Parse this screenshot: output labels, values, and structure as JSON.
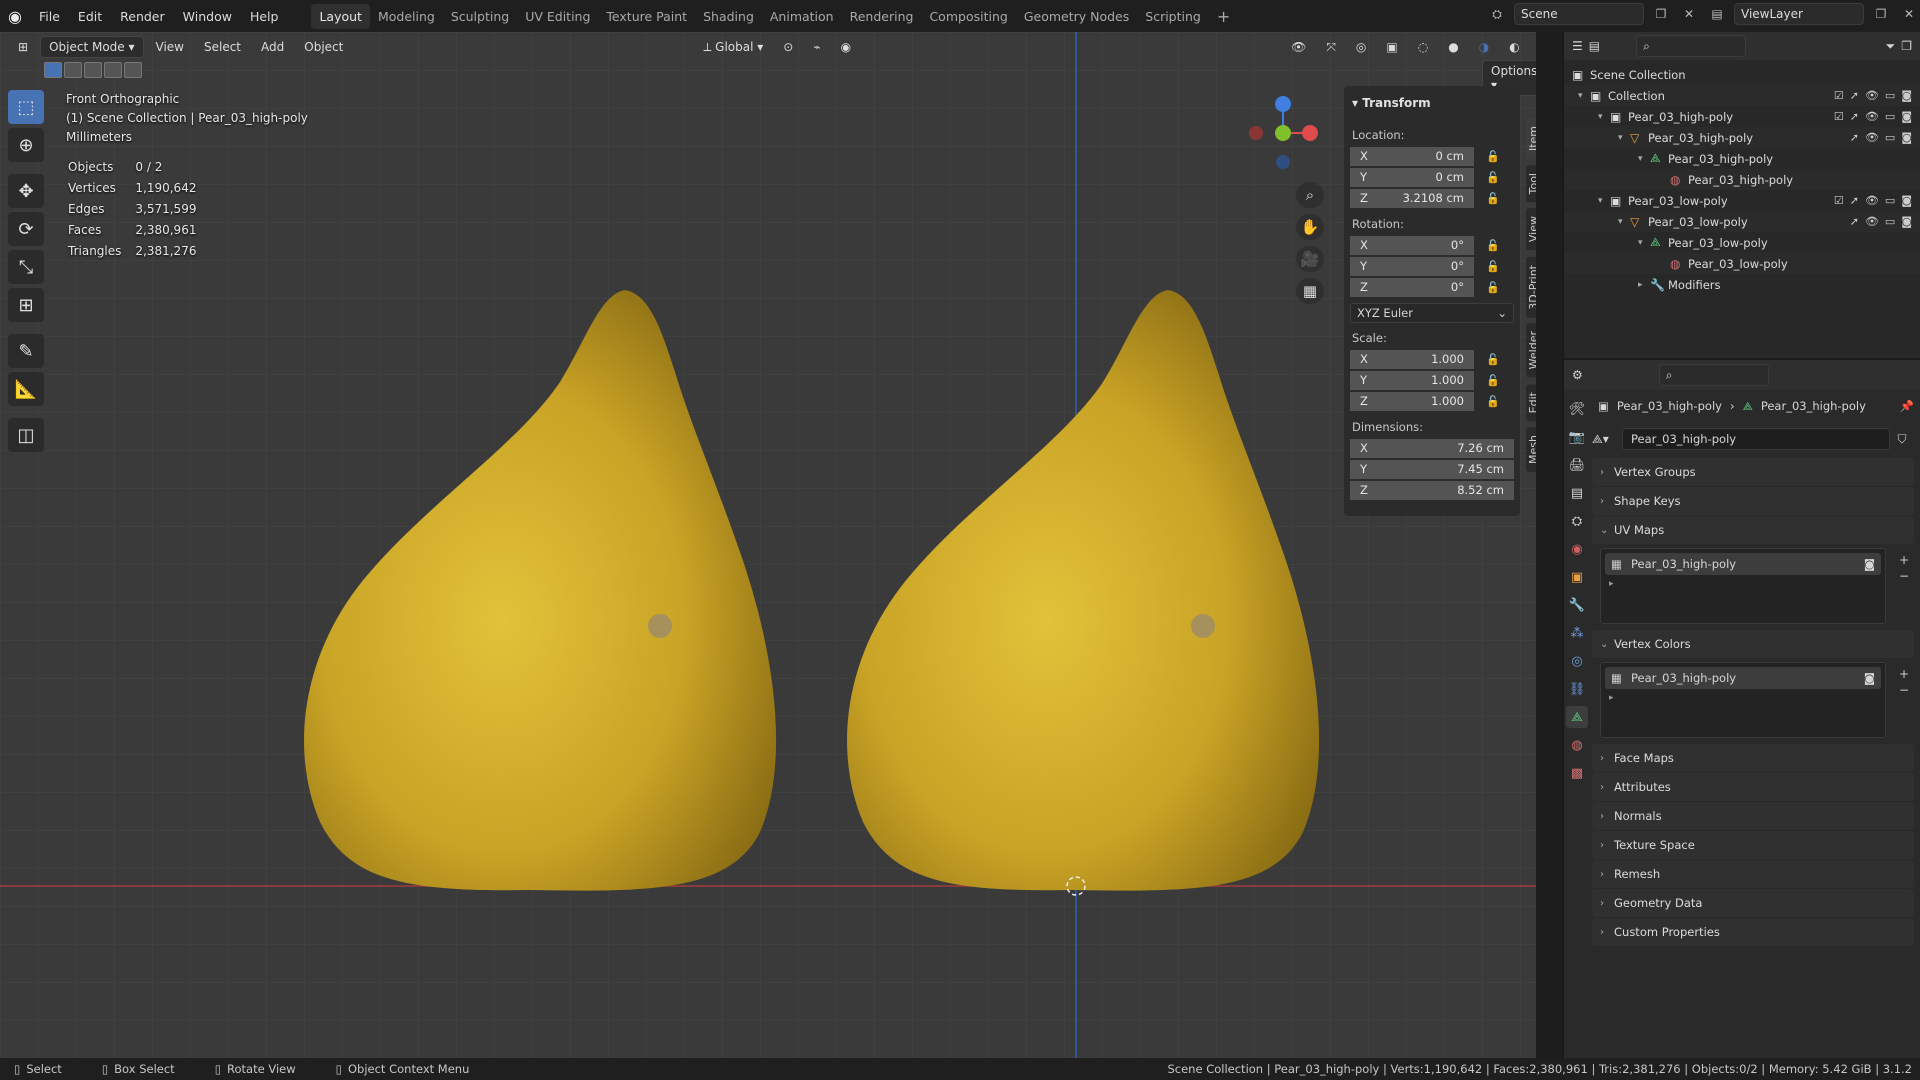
{
  "topbar": {
    "menu": [
      "File",
      "Edit",
      "Render",
      "Window",
      "Help"
    ],
    "workspaces": [
      "Layout",
      "Modeling",
      "Sculpting",
      "UV Editing",
      "Texture Paint",
      "Shading",
      "Animation",
      "Rendering",
      "Compositing",
      "Geometry Nodes",
      "Scripting"
    ],
    "active_workspace": "Layout",
    "scene": "Scene",
    "view_layer": "ViewLayer"
  },
  "viewport_header": {
    "mode": "Object Mode",
    "menus": [
      "View",
      "Select",
      "Add",
      "Object"
    ],
    "orientation": "Global",
    "options": "Options"
  },
  "overlay": {
    "view_name": "Front Orthographic",
    "collection": "(1) Scene Collection | Pear_03_high-poly",
    "units": "Millimeters"
  },
  "stats": [
    {
      "label": "Objects",
      "value": "0 / 2"
    },
    {
      "label": "Vertices",
      "value": "1,190,642"
    },
    {
      "label": "Edges",
      "value": "3,571,599"
    },
    {
      "label": "Faces",
      "value": "2,380,961"
    },
    {
      "label": "Triangles",
      "value": "2,381,276"
    }
  ],
  "transform": {
    "title": "Transform",
    "location_label": "Location:",
    "location": [
      {
        "axis": "X",
        "value": "0 cm"
      },
      {
        "axis": "Y",
        "value": "0 cm"
      },
      {
        "axis": "Z",
        "value": "3.2108 cm"
      }
    ],
    "rotation_label": "Rotation:",
    "rotation": [
      {
        "axis": "X",
        "value": "0°"
      },
      {
        "axis": "Y",
        "value": "0°"
      },
      {
        "axis": "Z",
        "value": "0°"
      }
    ],
    "rotation_mode": "XYZ Euler",
    "scale_label": "Scale:",
    "scale": [
      {
        "axis": "X",
        "value": "1.000"
      },
      {
        "axis": "Y",
        "value": "1.000"
      },
      {
        "axis": "Z",
        "value": "1.000"
      }
    ],
    "dimensions_label": "Dimensions:",
    "dimensions": [
      {
        "axis": "X",
        "value": "7.26 cm"
      },
      {
        "axis": "Y",
        "value": "7.45 cm"
      },
      {
        "axis": "Z",
        "value": "8.52 cm"
      }
    ]
  },
  "side_tabs": [
    "Item",
    "Tool",
    "View",
    "3D-Print",
    "Welder",
    "Edit",
    "Mesh"
  ],
  "outliner": {
    "items": [
      {
        "label": "Scene Collection",
        "depth": 0,
        "icon": "scene-collection-icon"
      },
      {
        "label": "Collection",
        "depth": 1,
        "icon": "collection-icon"
      },
      {
        "label": "Pear_03_high-poly",
        "depth": 2,
        "icon": "collection-icon"
      },
      {
        "label": "Pear_03_high-poly",
        "depth": 3,
        "icon": "object-icon"
      },
      {
        "label": "Pear_03_high-poly",
        "depth": 4,
        "icon": "mesh-icon"
      },
      {
        "label": "Pear_03_high-poly",
        "depth": 5,
        "icon": "material-icon"
      },
      {
        "label": "Pear_03_low-poly",
        "depth": 2,
        "icon": "collection-icon"
      },
      {
        "label": "Pear_03_low-poly",
        "depth": 3,
        "icon": "object-icon"
      },
      {
        "label": "Pear_03_low-poly",
        "depth": 4,
        "icon": "mesh-icon"
      },
      {
        "label": "Pear_03_low-poly",
        "depth": 5,
        "icon": "material-icon"
      },
      {
        "label": "Modifiers",
        "depth": 4,
        "icon": "wrench-icon"
      }
    ]
  },
  "properties": {
    "breadcrumb_object": "Pear_03_high-poly",
    "breadcrumb_data": "Pear_03_high-poly",
    "data_name": "Pear_03_high-poly",
    "sections": {
      "vertex_groups": "Vertex Groups",
      "shape_keys": "Shape Keys",
      "uv_maps": "UV Maps",
      "uv_map_item": "Pear_03_high-poly",
      "vertex_colors": "Vertex Colors",
      "vertex_color_item": "Pear_03_high-poly",
      "rest": [
        "Face Maps",
        "Attributes",
        "Normals",
        "Texture Space",
        "Remesh",
        "Geometry Data",
        "Custom Properties"
      ]
    }
  },
  "statusbar": {
    "select": "Select",
    "box_select": "Box Select",
    "rotate_view": "Rotate View",
    "context_menu": "Object Context Menu",
    "info": "Scene Collection | Pear_03_high-poly | Verts:1,190,642 | Faces:2,380,961 | Tris:2,381,276 | Objects:0/2 | Memory: 5.42 GiB | 3.1.2"
  },
  "colors": {
    "accent": "#4772b3",
    "pear_yellow": "#d8b52a",
    "axis_x": "#e04b4b",
    "axis_y": "#7fbf2a",
    "axis_z": "#3f7fe0"
  }
}
